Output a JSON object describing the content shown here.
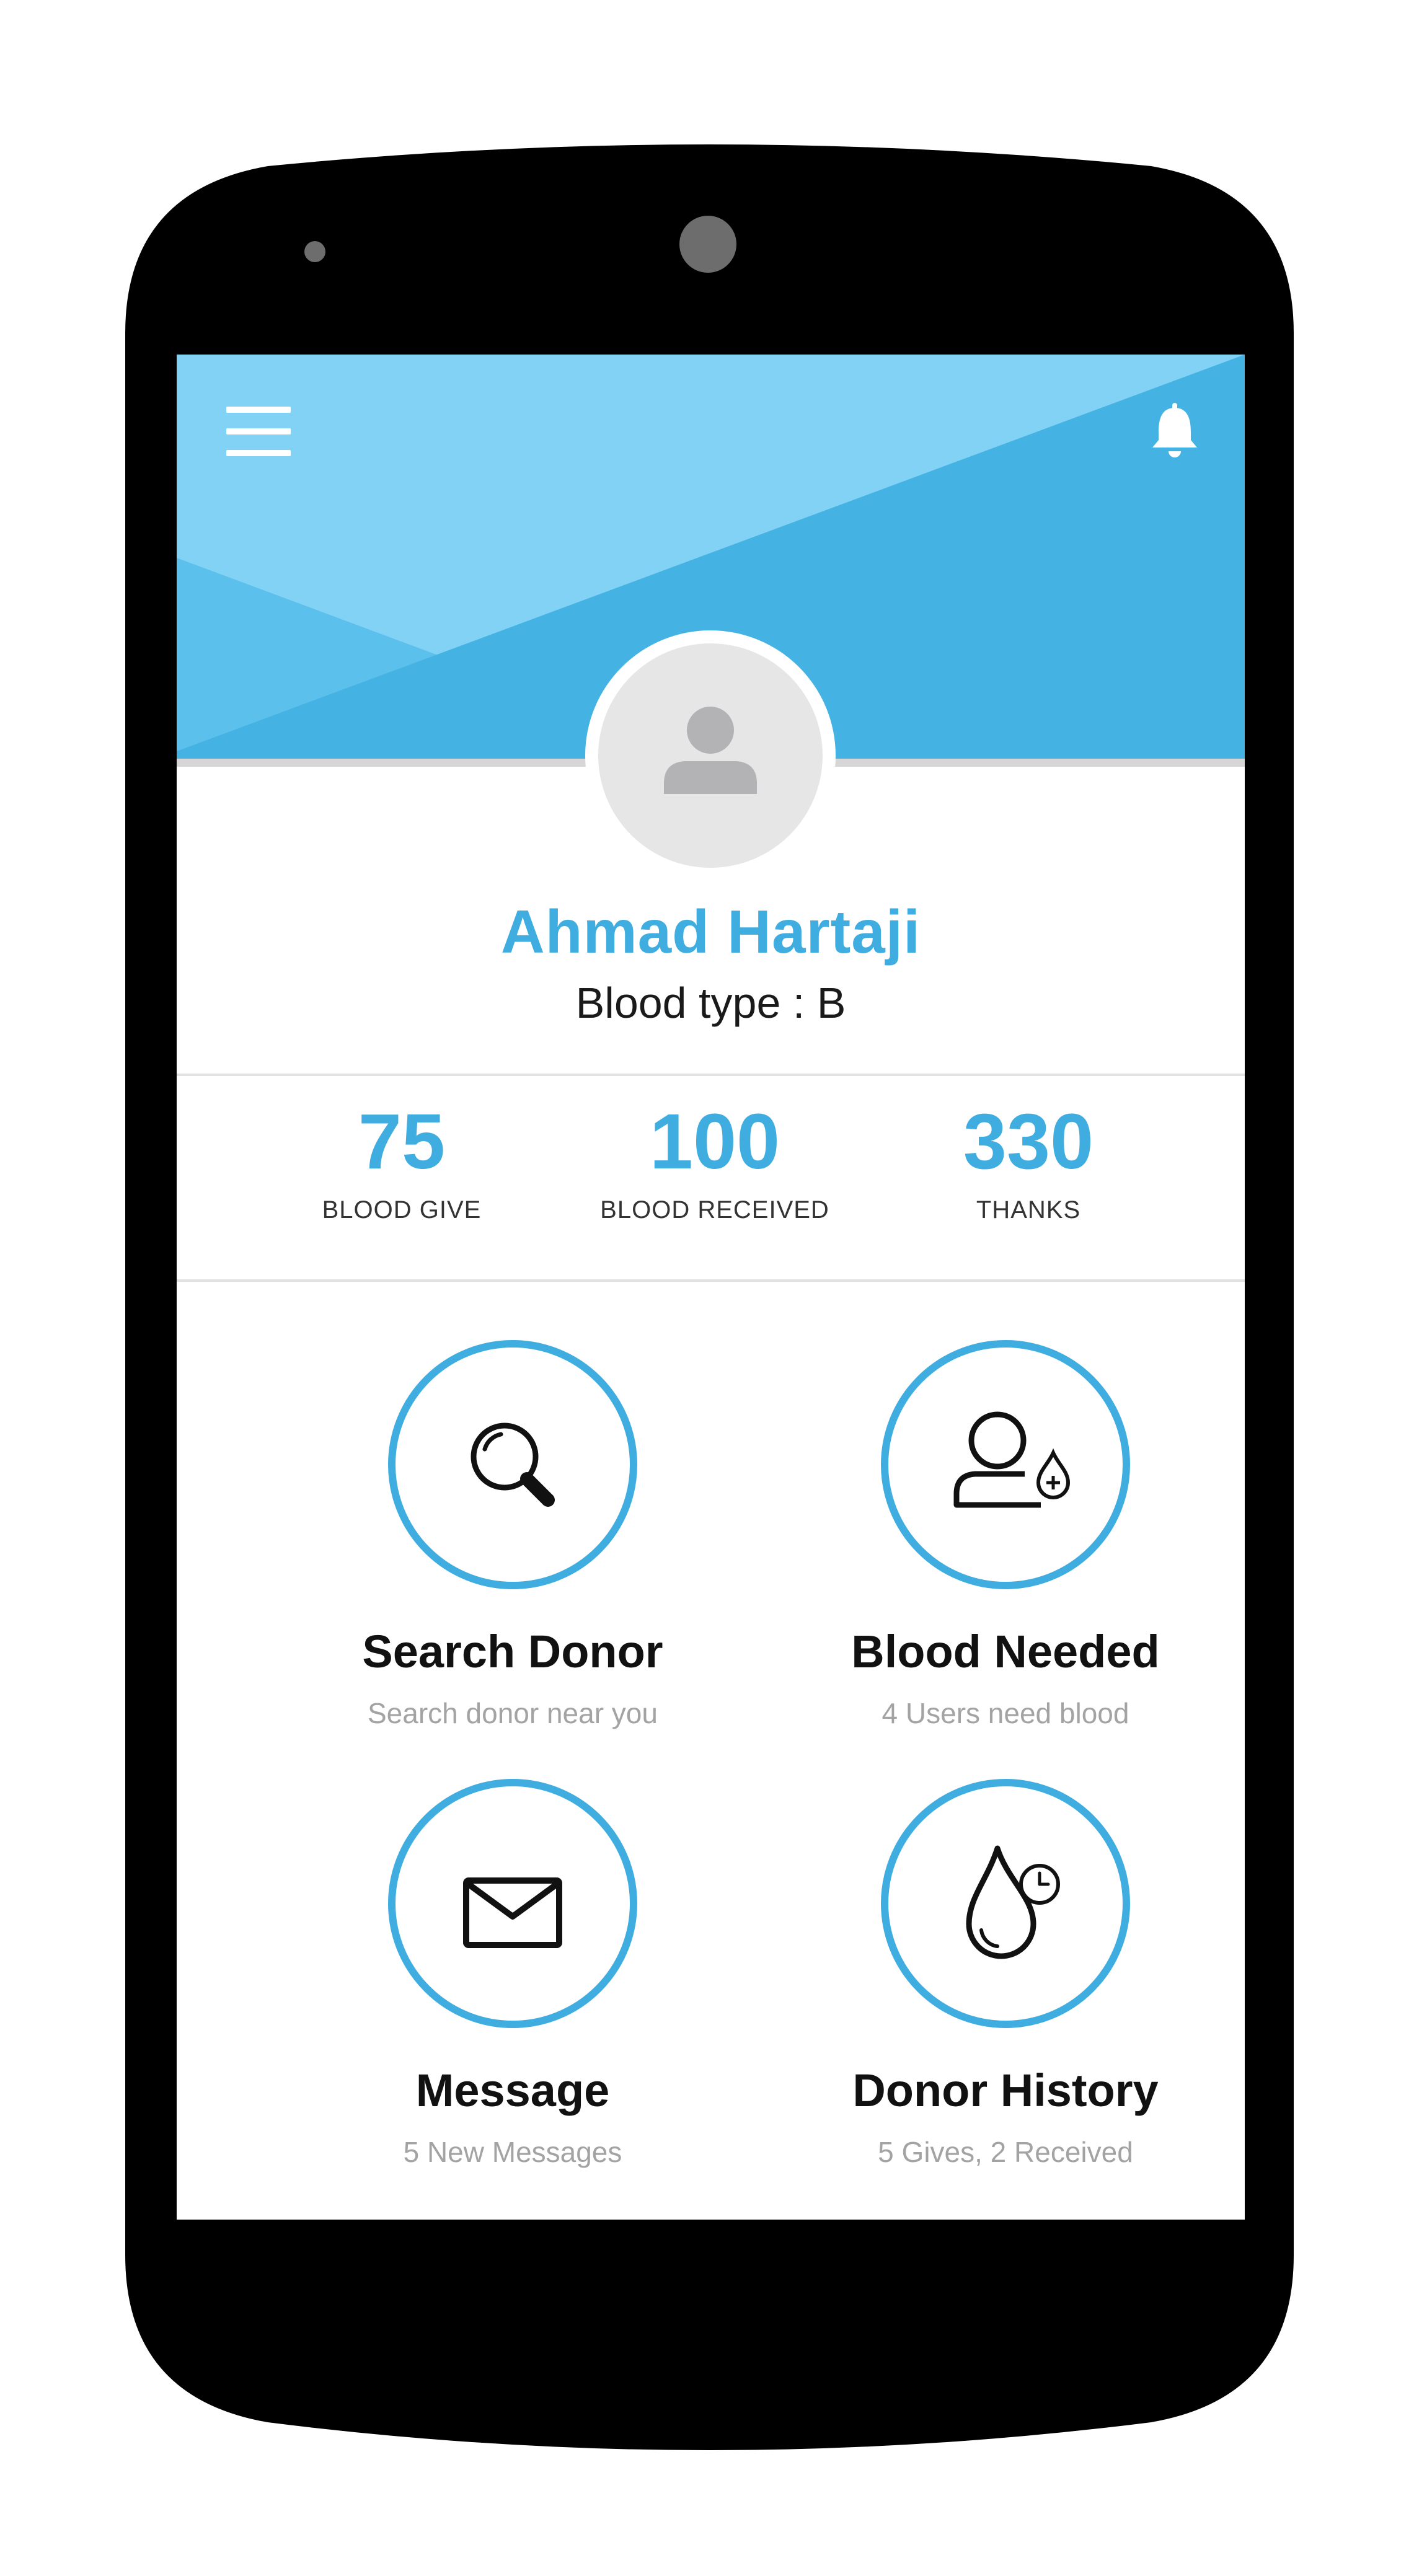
{
  "header": {
    "menu_icon": "hamburger-menu-icon",
    "notification_icon": "bell-icon",
    "colors": {
      "light": "#82d2f5",
      "mid": "#5cc0ec",
      "dark": "#44b3e4"
    }
  },
  "profile": {
    "avatar_icon": "user-avatar-icon",
    "name": "Ahmad Hartaji",
    "blood_type": "Blood type : B"
  },
  "stats": [
    {
      "value": "75",
      "label": "BLOOD GIVE"
    },
    {
      "value": "100",
      "label": "BLOOD RECEIVED"
    },
    {
      "value": "330",
      "label": "THANKS"
    }
  ],
  "tiles": [
    {
      "icon": "search-icon",
      "title": "Search Donor",
      "subtitle": "Search donor near you"
    },
    {
      "icon": "user-blood-drop-icon",
      "title": "Blood Needed",
      "subtitle": "4 Users need blood"
    },
    {
      "icon": "envelope-icon",
      "title": "Message",
      "subtitle": "5 New Messages"
    },
    {
      "icon": "blood-drop-clock-icon",
      "title": "Donor History",
      "subtitle": "5 Gives, 2 Received"
    }
  ],
  "accent_color": "#40ade1"
}
